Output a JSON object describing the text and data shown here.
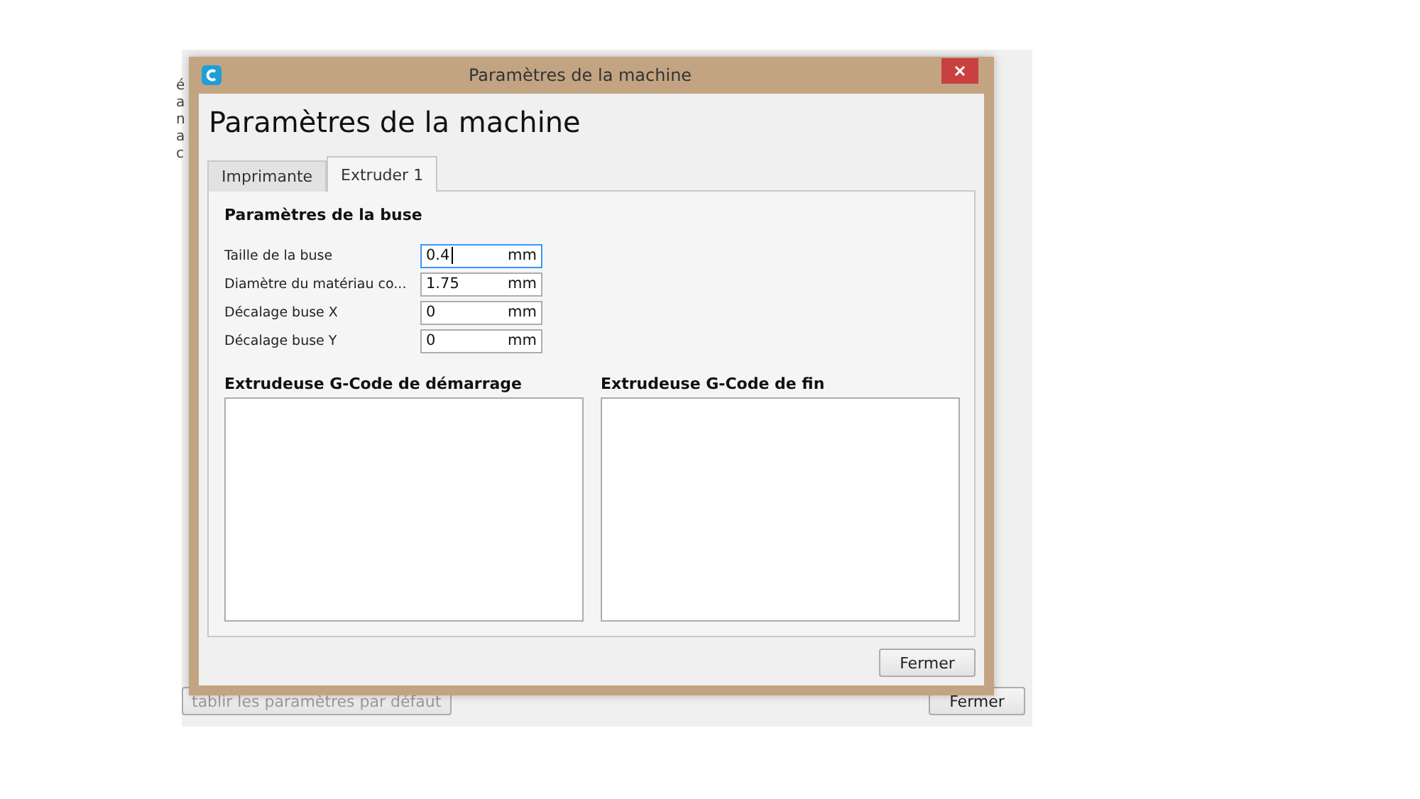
{
  "background_window": {
    "left_fragments": [
      "é",
      "a",
      "n",
      "a",
      "c"
    ],
    "buttons": [
      {
        "label": "tablir les paramètres par défaut",
        "disabled": true
      },
      {
        "label": "Fermer",
        "disabled": false
      }
    ]
  },
  "dialog": {
    "title": "Paramètres de la machine",
    "heading": "Paramètres de la machine",
    "tabs": [
      {
        "label": "Imprimante",
        "selected": false
      },
      {
        "label": "Extruder 1",
        "selected": true
      }
    ],
    "section_title": "Paramètres de la buse",
    "fields": [
      {
        "label": "Taille de la buse",
        "value": "0.4",
        "unit": "mm",
        "focused": true
      },
      {
        "label": "Diamètre du matériau co...",
        "value": "1.75",
        "unit": "mm",
        "focused": false
      },
      {
        "label": "Décalage buse X",
        "value": "0",
        "unit": "mm",
        "focused": false
      },
      {
        "label": "Décalage buse Y",
        "value": "0",
        "unit": "mm",
        "focused": false
      }
    ],
    "gcode": [
      {
        "label": "Extrudeuse G-Code de démarrage"
      },
      {
        "label": "Extrudeuse G-Code de fin"
      }
    ],
    "button": "Fermer"
  }
}
